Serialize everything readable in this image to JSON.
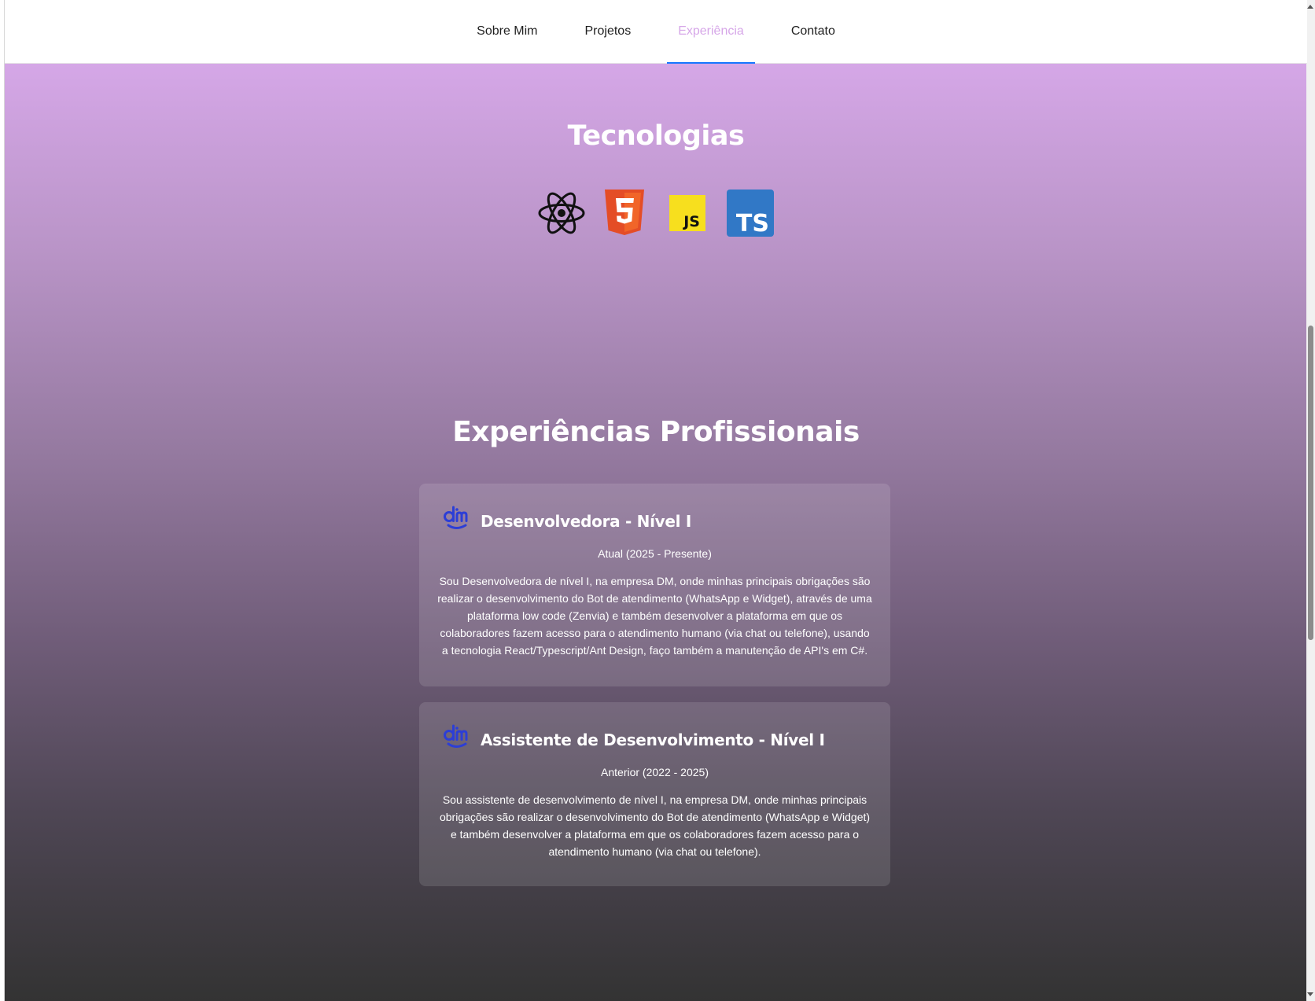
{
  "nav": {
    "items": [
      {
        "label": "Sobre Mim"
      },
      {
        "label": "Projetos"
      },
      {
        "label": "Experiência",
        "active": true
      },
      {
        "label": "Contato"
      }
    ],
    "active_color": "#d6a6e8",
    "underline_color": "#1677ff"
  },
  "tech": {
    "title": "Tecnologias",
    "icons": [
      "react-icon",
      "html5-icon",
      "javascript-icon",
      "typescript-icon"
    ],
    "js_label": "JS",
    "ts_label": "TS"
  },
  "experience": {
    "title": "Experiências Profissionais",
    "items": [
      {
        "icon": "dm-logo-icon",
        "role": "Desenvolvedora - Nível I",
        "period": "Atual (2025 - Presente)",
        "description": "Sou Desenvolvedora de nível I, na empresa DM, onde minhas principais obrigações são realizar o desenvolvimento do Bot de atendimento (WhatsApp e Widget), através de uma plataforma low code (Zenvia) e também desenvolver a plataforma em que os colaboradores fazem acesso para o atendimento humano (via chat ou telefone), usando a tecnologia React/Typescript/Ant Design, faço também a manutenção de API's em C#."
      },
      {
        "icon": "dm-logo-icon",
        "role": "Assistente de Desenvolvimento - Nível I",
        "period": "Anterior (2022 - 2025)",
        "description": "Sou assistente de desenvolvimento de nível I, na empresa DM, onde minhas principais obrigações são realizar o desenvolvimento do Bot de atendimento (WhatsApp e Widget) e também desenvolver a plataforma em que os colaboradores fazem acesso para o atendimento humano (via chat ou telefone)."
      }
    ]
  },
  "colors": {
    "gradient_top": "#d5a7e7",
    "gradient_bottom": "#333333",
    "dm_logo": "#2c3ed6",
    "html5": "#e44d26",
    "javascript": "#f7df1e",
    "typescript": "#3178c6"
  }
}
